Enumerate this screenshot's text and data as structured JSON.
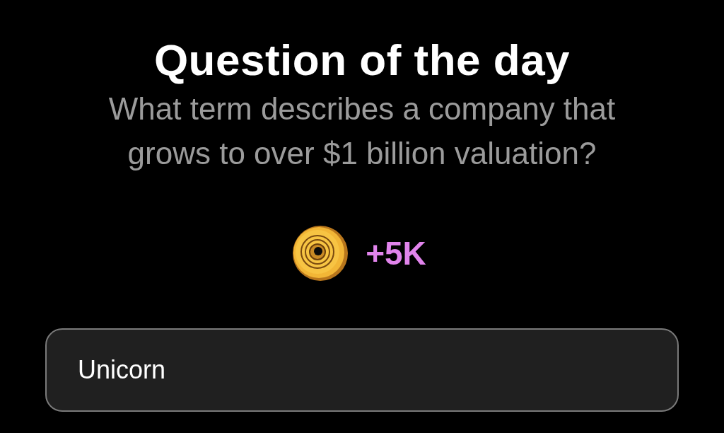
{
  "header": {
    "title": "Question of the day",
    "question": "What term describes a company that grows to over $1 billion valuation?"
  },
  "reward": {
    "amount": "+5K"
  },
  "answer_field": {
    "value": "Unicorn"
  }
}
